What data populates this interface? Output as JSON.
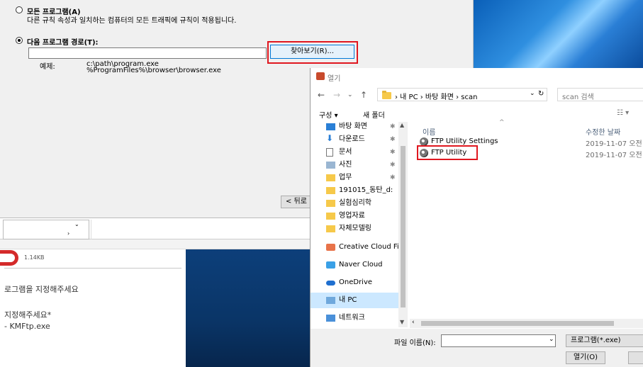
{
  "wizard": {
    "option_all": "모든 프로그램(A)",
    "option_all_desc": "다른 규칙 속성과 일치하는 컴퓨터의 모든 트래픽에 규칙이 적용됩니다.",
    "option_path": "다음 프로그램 경로(T):",
    "path_value": "",
    "browse_label": "찾아보기(R)...",
    "example_label": "예제:",
    "example_1": "c:\\path\\program.exe",
    "example_2": "%ProgramFiles%\\browser\\browser.exe",
    "back_label": "< 뒤로"
  },
  "bg_app": {
    "file_size": "1.14KB",
    "line1": "로그램을 지정해주세요",
    "line2": "지정해주세요*",
    "line3": "- KMFtp.exe"
  },
  "dialog": {
    "title": "열기",
    "breadcrumb": "› 내 PC › 바탕 화면 › scan",
    "search_placeholder": "scan 검색",
    "organize": "구성 ▾",
    "new_folder": "새 폴더",
    "nav_items": [
      {
        "label": "바탕 화면",
        "pinned": true
      },
      {
        "label": "다운로드",
        "pinned": true
      },
      {
        "label": "문서",
        "pinned": true
      },
      {
        "label": "사진",
        "pinned": true
      },
      {
        "label": "업무",
        "pinned": true
      },
      {
        "label": "191015_동탄_d:",
        "pinned": false
      },
      {
        "label": "실험심리학",
        "pinned": false
      },
      {
        "label": "영업자료",
        "pinned": false
      },
      {
        "label": "자체모델링",
        "pinned": false
      },
      {
        "label": "Creative Cloud Fil",
        "pinned": false
      },
      {
        "label": "Naver Cloud",
        "pinned": false
      },
      {
        "label": "OneDrive",
        "pinned": false
      },
      {
        "label": "내 PC",
        "pinned": false
      },
      {
        "label": "네트워크",
        "pinned": false
      }
    ],
    "columns": {
      "name": "이름",
      "date": "수정한 날짜"
    },
    "files": [
      {
        "name": "FTP Utility Settings",
        "date": "2019-11-07 오전"
      },
      {
        "name": "FTP Utility",
        "date": "2019-11-07 오전"
      }
    ],
    "filename_label": "파일 이름(N):",
    "filename_value": "",
    "filter": "프로그램(*.exe)",
    "open_label": "열기(O)",
    "colors": {
      "selection": "#cce8ff",
      "highlight_box": "#e0171f"
    }
  }
}
